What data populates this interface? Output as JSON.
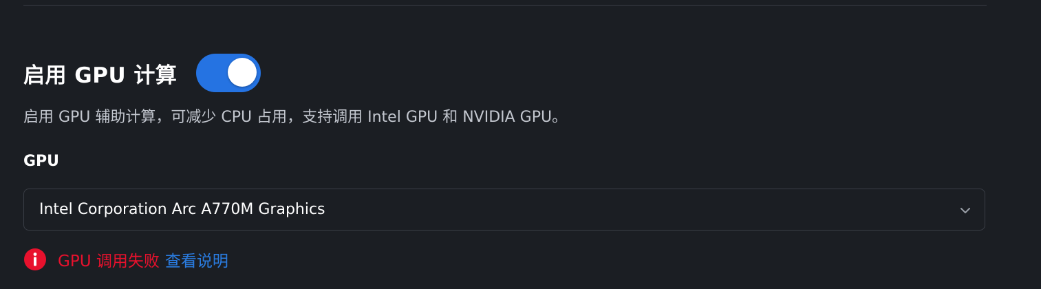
{
  "gpu_compute": {
    "title": "启用 GPU 计算",
    "enabled": true,
    "description": "启用 GPU 辅助计算，可减少 CPU 占用，支持调用 Intel GPU 和 NVIDIA GPU。"
  },
  "gpu_select": {
    "label": "GPU",
    "selected": "Intel Corporation Arc A770M Graphics",
    "dropdown_icon": "chevron-down-icon"
  },
  "error": {
    "icon": "info-circle-icon",
    "message": "GPU 调用失败",
    "link_text": "查看说明"
  },
  "colors": {
    "background": "#1b1e23",
    "toggle_on": "#2573e2",
    "error": "#e8112d",
    "link": "#2a7ce0"
  }
}
